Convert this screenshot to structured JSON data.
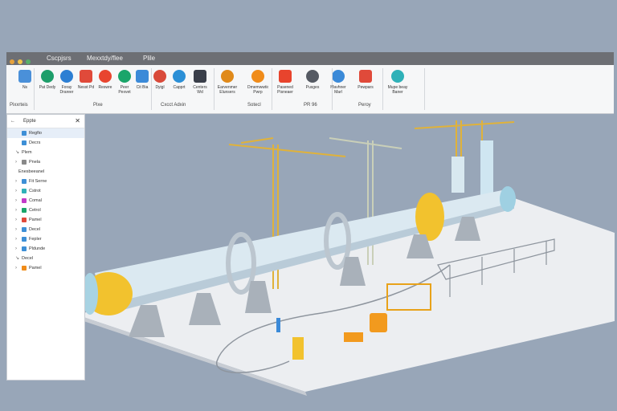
{
  "titlebar": {
    "tab1": "Cscpjsrs",
    "tab2": "Mexxtdy/flee",
    "tab3": "Plile"
  },
  "ribbon": {
    "buttons": [
      {
        "label": "Ns",
        "icon": "document-icon",
        "color": "#4a90d9"
      },
      {
        "label": "Pat Dedy",
        "icon": "globe-icon",
        "color": "#1e9e6a"
      },
      {
        "label": "Foray Drareer",
        "icon": "cube-icon",
        "color": "#2c7fd3"
      },
      {
        "label": "Nesst Pd",
        "icon": "refresh-icon",
        "color": "#e04a3a"
      },
      {
        "label": "Reswre",
        "icon": "circle-icon",
        "color": "#e8452f"
      },
      {
        "label": "Peer Pexvet",
        "icon": "diamond-icon",
        "color": "#1aa56a"
      },
      {
        "label": "Cit Bia",
        "icon": "target-icon",
        "color": "#3b8ad8"
      },
      {
        "label": "Dyigl",
        "icon": "image-icon",
        "color": "#d94a3a"
      },
      {
        "label": "Capprt",
        "icon": "screen-icon",
        "color": "#2b8fd6"
      },
      {
        "label": "Centers Wd",
        "icon": "grid-icon",
        "color": "#3a3f4a"
      },
      {
        "label": "Earvenmer Elunsers",
        "icon": "ring-icon",
        "color": "#e08a1a"
      },
      {
        "label": "Dmemwwtion Pwrp",
        "icon": "box-icon",
        "color": "#f08c1a"
      },
      {
        "label": "Pasened Pisneaer",
        "icon": "palette-icon",
        "color": "#e8442d"
      },
      {
        "label": "Pusges",
        "icon": "wrench-icon",
        "color": "#555a63"
      },
      {
        "label": "Mavhner Marl",
        "icon": "folder-icon",
        "color": "#3b8ad8"
      },
      {
        "label": "Pewpars",
        "icon": "chart-icon",
        "color": "#e04a3a"
      },
      {
        "label": "Mupe beay Baner",
        "icon": "cylinder-icon",
        "color": "#2fb1b8"
      }
    ],
    "groups": [
      "Pixxrteis",
      "Pixe",
      "Cxcct Adxin",
      "Sotecl",
      "PR 96",
      "Peroy"
    ]
  },
  "panel": {
    "title": "Eppte",
    "items": [
      {
        "label": "Regfio",
        "color": "#3d8fd6",
        "indent": 1,
        "selected": true,
        "arrow": ""
      },
      {
        "label": "Decrs",
        "color": "#3d8fd6",
        "indent": 1,
        "selected": false,
        "arrow": ""
      },
      {
        "label": "Plem",
        "color": "",
        "indent": 1,
        "selected": false,
        "arrow": "↘"
      },
      {
        "label": "Pnela",
        "color": "#888888",
        "indent": 1,
        "selected": false,
        "arrow": "›"
      },
      {
        "label": "Enesbeeanel",
        "color": "",
        "indent": 0,
        "selected": false,
        "arrow": ""
      },
      {
        "label": "Fit Serne",
        "color": "#3d8fd6",
        "indent": 1,
        "selected": false,
        "arrow": "›"
      },
      {
        "label": "Cstrot",
        "color": "#2fb1b8",
        "indent": 1,
        "selected": false,
        "arrow": "›"
      },
      {
        "label": "Comal",
        "color": "#c23ac8",
        "indent": 1,
        "selected": false,
        "arrow": "›"
      },
      {
        "label": "Cetrol",
        "color": "#1aa56a",
        "indent": 1,
        "selected": false,
        "arrow": "›"
      },
      {
        "label": "Pamel",
        "color": "#e04a3a",
        "indent": 1,
        "selected": false,
        "arrow": "›"
      },
      {
        "label": "Decel",
        "color": "#3d8fd6",
        "indent": 1,
        "selected": false,
        "arrow": "›"
      },
      {
        "label": "Fepler",
        "color": "#3d8fd6",
        "indent": 1,
        "selected": false,
        "arrow": "›"
      },
      {
        "label": "Pldunde",
        "color": "#3d8fd6",
        "indent": 1,
        "selected": false,
        "arrow": "›"
      },
      {
        "label": "Decel",
        "color": "",
        "indent": 1,
        "selected": false,
        "arrow": "↘"
      },
      {
        "label": "Pamel",
        "color": "#f08c1a",
        "indent": 1,
        "selected": false,
        "arrow": "›"
      }
    ]
  }
}
